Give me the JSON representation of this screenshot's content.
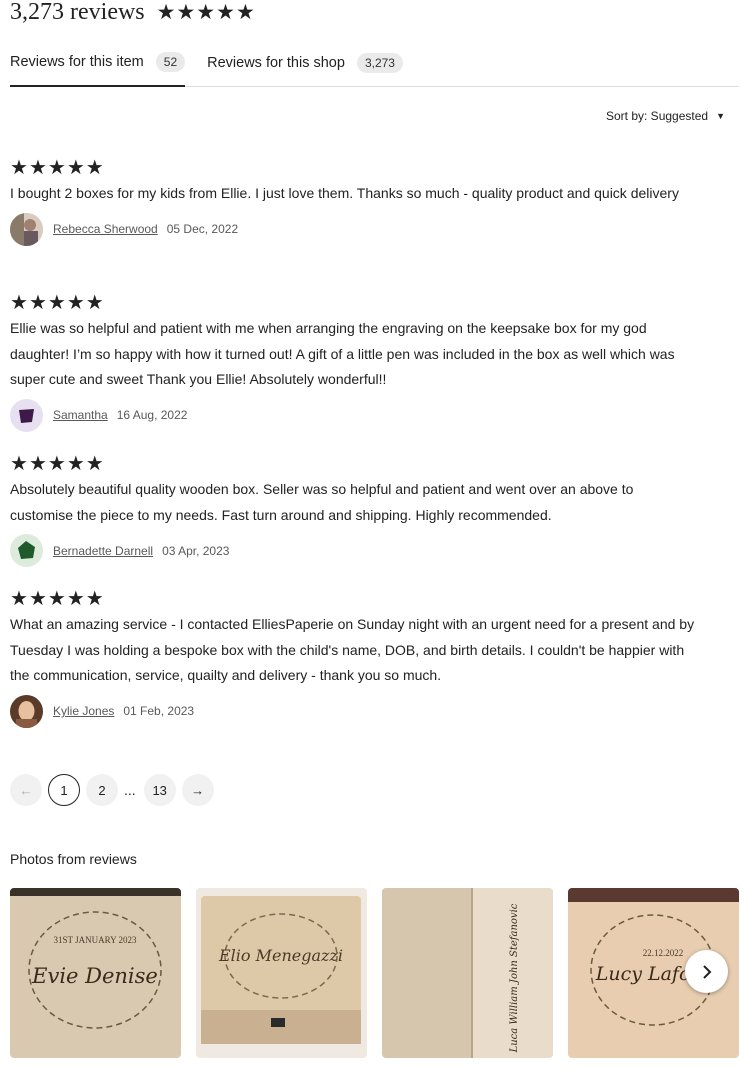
{
  "header": {
    "review_count": "3,273 reviews",
    "rating_stars": 5
  },
  "tabs": [
    {
      "label": "Reviews for this item",
      "count": "52",
      "active": true
    },
    {
      "label": "Reviews for this shop",
      "count": "3,273",
      "active": false
    }
  ],
  "sort": {
    "label": "Sort by: Suggested"
  },
  "reviews": [
    {
      "stars": 5,
      "text": "I bought 2 boxes for my kids from Ellie. I just love them. Thanks so much - quality product and quick delivery",
      "author": "Rebecca Sherwood",
      "date": "05 Dec, 2022"
    },
    {
      "stars": 5,
      "text": "Ellie was so helpful and patient with me when arranging the engraving on the keepsake box for my god daughter! I’m so happy with how it turned out! A gift of a little pen was included in the box as well which was super cute and sweet Thank you Ellie! Absolutely wonderful!!",
      "author": "Samantha",
      "date": "16 Aug, 2022"
    },
    {
      "stars": 5,
      "text": "Absolutely beautiful quality wooden box. Seller was so helpful and patient and went over an above to customise the piece to my needs. Fast turn around and shipping. Highly recommended.",
      "author": "Bernadette Darnell",
      "date": "03 Apr, 2023"
    },
    {
      "stars": 5,
      "text": "What an amazing service - I contacted ElliesPaperie on Sunday night with an urgent need for a present and by Tuesday I was holding a bespoke box with the child's name, DOB, and birth details. I couldn't be happier with the communication, service, quailty and delivery - thank you so much.",
      "author": "Kylie Jones",
      "date": "01 Feb, 2023"
    }
  ],
  "pagination": {
    "prev": "←",
    "pages": [
      "1",
      "2"
    ],
    "ellipsis": "...",
    "last": "13",
    "next": "→",
    "current": "1"
  },
  "photos": {
    "title": "Photos from reviews",
    "items": [
      {
        "date": "31ST JANUARY 2023",
        "name": "Evie Denise"
      },
      {
        "name": "Elio Menegazzi"
      },
      {
        "name": "Luca William John Stefanovic"
      },
      {
        "date": "22.12.2022",
        "name": "Lucy Lafont"
      }
    ]
  }
}
